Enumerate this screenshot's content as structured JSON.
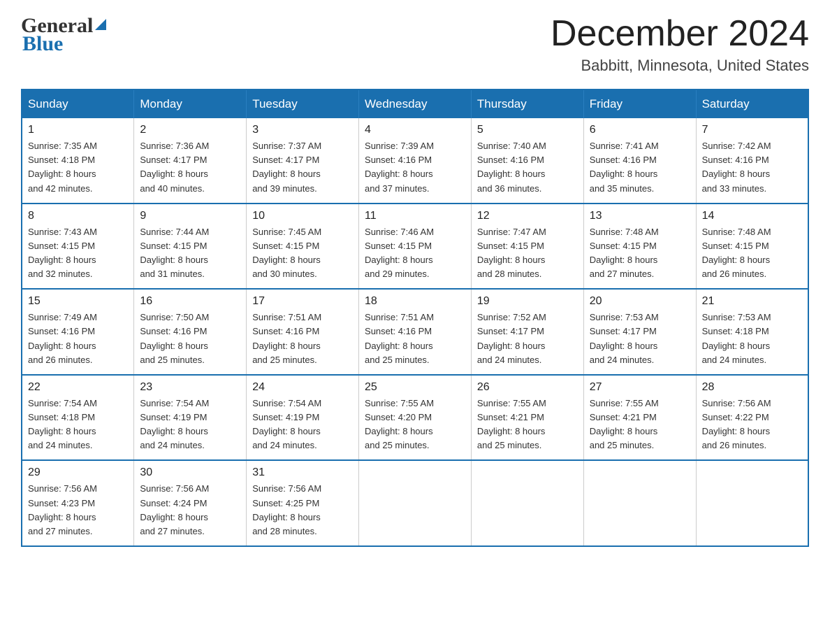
{
  "header": {
    "logo_line1": "General",
    "logo_line2": "Blue",
    "month_title": "December 2024",
    "location": "Babbitt, Minnesota, United States"
  },
  "weekdays": [
    "Sunday",
    "Monday",
    "Tuesday",
    "Wednesday",
    "Thursday",
    "Friday",
    "Saturday"
  ],
  "weeks": [
    [
      {
        "day": "1",
        "info": "Sunrise: 7:35 AM\nSunset: 4:18 PM\nDaylight: 8 hours\nand 42 minutes."
      },
      {
        "day": "2",
        "info": "Sunrise: 7:36 AM\nSunset: 4:17 PM\nDaylight: 8 hours\nand 40 minutes."
      },
      {
        "day": "3",
        "info": "Sunrise: 7:37 AM\nSunset: 4:17 PM\nDaylight: 8 hours\nand 39 minutes."
      },
      {
        "day": "4",
        "info": "Sunrise: 7:39 AM\nSunset: 4:16 PM\nDaylight: 8 hours\nand 37 minutes."
      },
      {
        "day": "5",
        "info": "Sunrise: 7:40 AM\nSunset: 4:16 PM\nDaylight: 8 hours\nand 36 minutes."
      },
      {
        "day": "6",
        "info": "Sunrise: 7:41 AM\nSunset: 4:16 PM\nDaylight: 8 hours\nand 35 minutes."
      },
      {
        "day": "7",
        "info": "Sunrise: 7:42 AM\nSunset: 4:16 PM\nDaylight: 8 hours\nand 33 minutes."
      }
    ],
    [
      {
        "day": "8",
        "info": "Sunrise: 7:43 AM\nSunset: 4:15 PM\nDaylight: 8 hours\nand 32 minutes."
      },
      {
        "day": "9",
        "info": "Sunrise: 7:44 AM\nSunset: 4:15 PM\nDaylight: 8 hours\nand 31 minutes."
      },
      {
        "day": "10",
        "info": "Sunrise: 7:45 AM\nSunset: 4:15 PM\nDaylight: 8 hours\nand 30 minutes."
      },
      {
        "day": "11",
        "info": "Sunrise: 7:46 AM\nSunset: 4:15 PM\nDaylight: 8 hours\nand 29 minutes."
      },
      {
        "day": "12",
        "info": "Sunrise: 7:47 AM\nSunset: 4:15 PM\nDaylight: 8 hours\nand 28 minutes."
      },
      {
        "day": "13",
        "info": "Sunrise: 7:48 AM\nSunset: 4:15 PM\nDaylight: 8 hours\nand 27 minutes."
      },
      {
        "day": "14",
        "info": "Sunrise: 7:48 AM\nSunset: 4:15 PM\nDaylight: 8 hours\nand 26 minutes."
      }
    ],
    [
      {
        "day": "15",
        "info": "Sunrise: 7:49 AM\nSunset: 4:16 PM\nDaylight: 8 hours\nand 26 minutes."
      },
      {
        "day": "16",
        "info": "Sunrise: 7:50 AM\nSunset: 4:16 PM\nDaylight: 8 hours\nand 25 minutes."
      },
      {
        "day": "17",
        "info": "Sunrise: 7:51 AM\nSunset: 4:16 PM\nDaylight: 8 hours\nand 25 minutes."
      },
      {
        "day": "18",
        "info": "Sunrise: 7:51 AM\nSunset: 4:16 PM\nDaylight: 8 hours\nand 25 minutes."
      },
      {
        "day": "19",
        "info": "Sunrise: 7:52 AM\nSunset: 4:17 PM\nDaylight: 8 hours\nand 24 minutes."
      },
      {
        "day": "20",
        "info": "Sunrise: 7:53 AM\nSunset: 4:17 PM\nDaylight: 8 hours\nand 24 minutes."
      },
      {
        "day": "21",
        "info": "Sunrise: 7:53 AM\nSunset: 4:18 PM\nDaylight: 8 hours\nand 24 minutes."
      }
    ],
    [
      {
        "day": "22",
        "info": "Sunrise: 7:54 AM\nSunset: 4:18 PM\nDaylight: 8 hours\nand 24 minutes."
      },
      {
        "day": "23",
        "info": "Sunrise: 7:54 AM\nSunset: 4:19 PM\nDaylight: 8 hours\nand 24 minutes."
      },
      {
        "day": "24",
        "info": "Sunrise: 7:54 AM\nSunset: 4:19 PM\nDaylight: 8 hours\nand 24 minutes."
      },
      {
        "day": "25",
        "info": "Sunrise: 7:55 AM\nSunset: 4:20 PM\nDaylight: 8 hours\nand 25 minutes."
      },
      {
        "day": "26",
        "info": "Sunrise: 7:55 AM\nSunset: 4:21 PM\nDaylight: 8 hours\nand 25 minutes."
      },
      {
        "day": "27",
        "info": "Sunrise: 7:55 AM\nSunset: 4:21 PM\nDaylight: 8 hours\nand 25 minutes."
      },
      {
        "day": "28",
        "info": "Sunrise: 7:56 AM\nSunset: 4:22 PM\nDaylight: 8 hours\nand 26 minutes."
      }
    ],
    [
      {
        "day": "29",
        "info": "Sunrise: 7:56 AM\nSunset: 4:23 PM\nDaylight: 8 hours\nand 27 minutes."
      },
      {
        "day": "30",
        "info": "Sunrise: 7:56 AM\nSunset: 4:24 PM\nDaylight: 8 hours\nand 27 minutes."
      },
      {
        "day": "31",
        "info": "Sunrise: 7:56 AM\nSunset: 4:25 PM\nDaylight: 8 hours\nand 28 minutes."
      },
      {
        "day": "",
        "info": ""
      },
      {
        "day": "",
        "info": ""
      },
      {
        "day": "",
        "info": ""
      },
      {
        "day": "",
        "info": ""
      }
    ]
  ]
}
